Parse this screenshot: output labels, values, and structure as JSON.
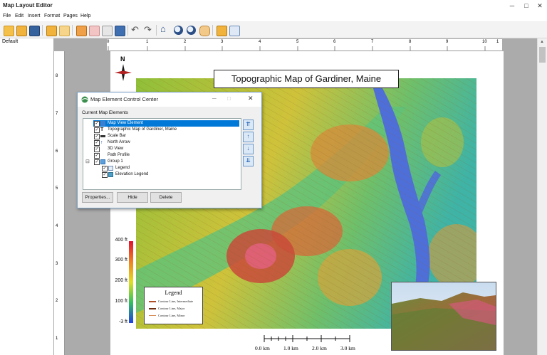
{
  "app": {
    "title": "Map Layout Editor",
    "window_controls": [
      "─",
      "□",
      "✕"
    ]
  },
  "menu": [
    "File",
    "Edit",
    "Insert",
    "Format",
    "Pages",
    "Help"
  ],
  "toolbar_icons": [
    "new-document-icon",
    "open-folder-icon",
    "save-icon",
    "copy-icon",
    "paste-icon",
    "insert-page-icon",
    "new-layer-icon",
    "edit-icon",
    "layers-icon",
    "undo-icon",
    "redo-icon",
    "home-icon",
    "zoom-in-icon",
    "zoom-out-icon",
    "pan-hand-icon",
    "select-pointer-icon",
    "zoom-window-icon"
  ],
  "left_panel": {
    "item": "Default"
  },
  "ruler": {
    "h_labels": [
      "0",
      "1",
      "2",
      "3",
      "4",
      "5",
      "6",
      "7",
      "8",
      "9",
      "10",
      "1"
    ],
    "v_labels": [
      "8",
      "7",
      "6",
      "5",
      "4",
      "3",
      "2",
      "1"
    ]
  },
  "map": {
    "title": "Topographic Map of Gardiner, Maine",
    "north_label": "N",
    "elevation_labels": [
      "400 ft",
      "300 ft",
      "200 ft",
      "100 ft",
      "-3 ft"
    ],
    "legend": {
      "title": "Legend",
      "items": [
        {
          "label": "Contour Line, Intermediate",
          "color": "#b0502a"
        },
        {
          "label": "Contour Line, Major",
          "color": "#6b2c0f"
        },
        {
          "label": "Contour Line, Minor",
          "color": "#d98c5a"
        }
      ]
    },
    "scale_labels": [
      "0.0 km",
      "1.0 km",
      "2.0 km",
      "3.0 km"
    ]
  },
  "dialog": {
    "title": "Map Element Control Center",
    "window_controls": [
      "─",
      "□",
      "✕"
    ],
    "section_label": "Current Map Elements",
    "elements": [
      {
        "label": "Map View Element",
        "level": 0,
        "selected": true,
        "icon": "map-view-icon"
      },
      {
        "label": "Topographic Map of Gardiner, Maine",
        "level": 0,
        "selected": false,
        "icon": "text-icon"
      },
      {
        "label": "Scale Bar",
        "level": 0,
        "selected": false,
        "icon": "scale-bar-icon"
      },
      {
        "label": "North Arrow",
        "level": 0,
        "selected": false,
        "icon": "north-arrow-icon"
      },
      {
        "label": "3D View",
        "level": 0,
        "selected": false,
        "icon": ""
      },
      {
        "label": "Path Profile",
        "level": 0,
        "selected": false,
        "icon": ""
      },
      {
        "label": "Group 1",
        "level": 0,
        "selected": false,
        "icon": "group-icon",
        "expander": "⊟"
      },
      {
        "label": "Legend",
        "level": 1,
        "selected": false,
        "icon": "legend-icon"
      },
      {
        "label": "Elevation Legend",
        "level": 1,
        "selected": false,
        "icon": "elevation-legend-icon"
      }
    ],
    "order_buttons": [
      "⇈",
      "↑",
      "↓",
      "⇊"
    ],
    "buttons": {
      "properties": "Properties...",
      "hide": "Hide",
      "delete": "Delete"
    }
  },
  "colors": {
    "selection": "#0078d7",
    "accent_blue": "#1f5fb4",
    "river": "#4f6fd8"
  }
}
